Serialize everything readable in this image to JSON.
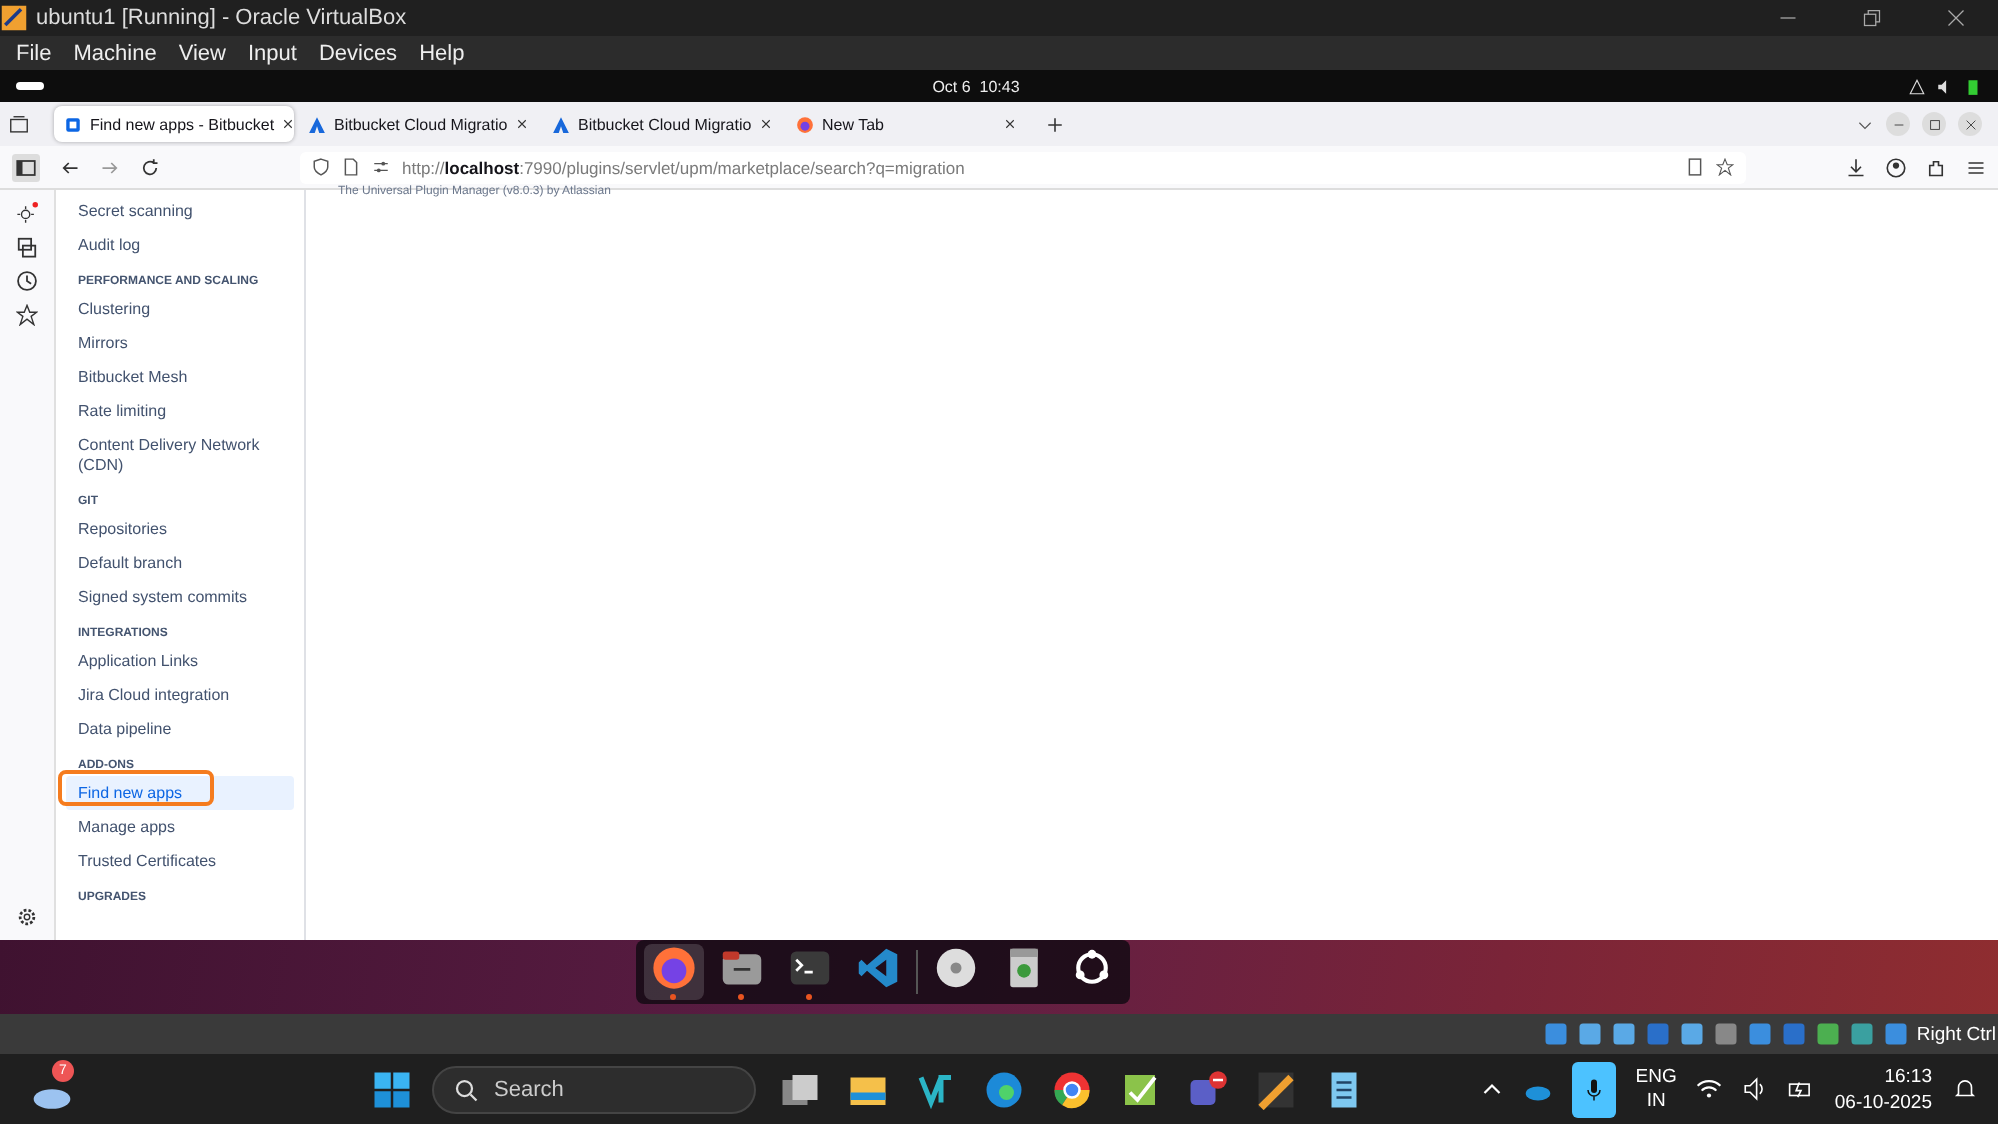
{
  "vm_window": {
    "title": "ubuntu1 [Running] - Oracle VirtualBox",
    "menu": [
      "File",
      "Machine",
      "View",
      "Input",
      "Devices",
      "Help"
    ]
  },
  "ubuntu_top_bar": {
    "clock": "Oct 6  10:43"
  },
  "browser": {
    "tabs": [
      {
        "title": "Find new apps - Bitbucket",
        "kind": "bitbucket",
        "selected": true
      },
      {
        "title": "Bitbucket Cloud Migratio",
        "kind": "atlassian",
        "selected": false
      },
      {
        "title": "Bitbucket Cloud Migratio",
        "kind": "atlassian",
        "selected": false
      },
      {
        "title": "New Tab",
        "kind": "firefox",
        "selected": false
      }
    ],
    "url": "http://**localhost**:7990/plugins/servlet/upm/marketplace/search?q=migration"
  },
  "page": {
    "footer_text": "The Universal Plugin Manager (v8.0.3) by Atlassian",
    "sidebar": {
      "items": [
        {
          "label": "Secret scanning",
          "selected": false
        },
        {
          "label": "Audit log",
          "selected": false
        }
      ],
      "sections": [
        {
          "heading": "PERFORMANCE AND SCALING",
          "items": [
            {
              "label": "Clustering",
              "selected": false
            },
            {
              "label": "Mirrors",
              "selected": false
            },
            {
              "label": "Bitbucket Mesh",
              "selected": false
            },
            {
              "label": "Rate limiting",
              "selected": false
            },
            {
              "label": "Content Delivery Network (CDN)",
              "selected": false
            }
          ]
        },
        {
          "heading": "GIT",
          "items": [
            {
              "label": "Repositories",
              "selected": false
            },
            {
              "label": "Default branch",
              "selected": false
            },
            {
              "label": "Signed system commits",
              "selected": false
            }
          ]
        },
        {
          "heading": "INTEGRATIONS",
          "items": [
            {
              "label": "Application Links",
              "selected": false
            },
            {
              "label": "Jira Cloud integration",
              "selected": false
            },
            {
              "label": "Data pipeline",
              "selected": false
            }
          ]
        },
        {
          "heading": "ADD-ONS",
          "items": [
            {
              "label": "Find new apps",
              "selected": true
            },
            {
              "label": "Manage apps",
              "selected": false
            },
            {
              "label": "Trusted Certificates",
              "selected": false
            }
          ]
        },
        {
          "heading": "UPGRADES"
        }
      ]
    }
  },
  "dock": {
    "apps": [
      {
        "kind": "firefox",
        "running": true,
        "active": true
      },
      {
        "kind": "files",
        "running": true,
        "active": false
      },
      {
        "kind": "terminal",
        "running": true,
        "active": false
      },
      {
        "kind": "vscode",
        "running": false,
        "active": false
      },
      {
        "kind": "disc",
        "running": false,
        "active": false
      },
      {
        "kind": "trash",
        "running": false,
        "active": false
      },
      {
        "kind": "ubuntu",
        "running": false,
        "active": false
      }
    ]
  },
  "vm_status_bar": {
    "host_key": "Right Ctrl"
  },
  "taskbar": {
    "weather_badge": "7",
    "search_placeholder": "Search",
    "language": "ENG",
    "region": "IN",
    "time": "16:13",
    "date": "06-10-2025"
  }
}
